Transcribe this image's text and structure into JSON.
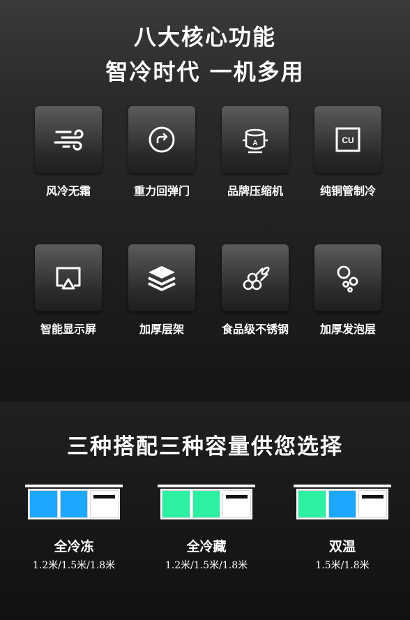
{
  "header": {
    "line1": "八大核心功能",
    "line2": "智冷时代 一机多用"
  },
  "features": [
    {
      "label": "风冷无霜",
      "icon": "wind-icon"
    },
    {
      "label": "重力回弹门",
      "icon": "rebound-door-icon"
    },
    {
      "label": "品牌压缩机",
      "icon": "compressor-icon"
    },
    {
      "label": "纯铜管制冷",
      "icon": "copper-icon"
    },
    {
      "label": "智能显示屏",
      "icon": "display-icon"
    },
    {
      "label": "加厚层架",
      "icon": "layers-icon"
    },
    {
      "label": "食品级不锈钢",
      "icon": "steel-pipes-icon"
    },
    {
      "label": "加厚发泡层",
      "icon": "foam-bubbles-icon"
    }
  ],
  "section": {
    "title": "三种搭配三种容量供您选择"
  },
  "options": [
    {
      "name": "全冷冻",
      "sizes": "1.2米/1.5米/1.8米",
      "doors": [
        "blue",
        "blue",
        "white"
      ]
    },
    {
      "name": "全冷藏",
      "sizes": "1.2米/1.5米/1.8米",
      "doors": [
        "green",
        "green",
        "white"
      ]
    },
    {
      "name": "双温",
      "sizes": "1.5米/1.8米",
      "doors": [
        "green",
        "blue",
        "white"
      ]
    }
  ],
  "colors": {
    "blue": "#1ea7ff",
    "green": "#2ef0a2",
    "white": "#ffffff"
  }
}
